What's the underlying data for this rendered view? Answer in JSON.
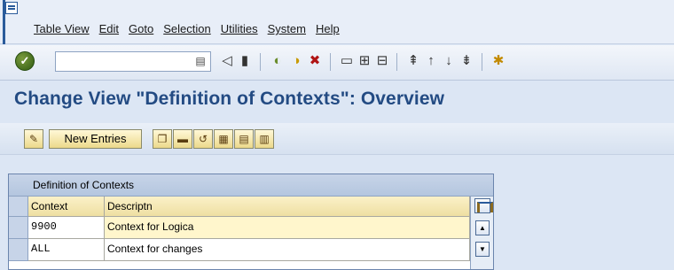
{
  "menu": [
    "Table View",
    "Edit",
    "Goto",
    "Selection",
    "Utilities",
    "System",
    "Help"
  ],
  "toolbar": {
    "command_value": "",
    "icons": [
      "enter-icon",
      "save-icon",
      "back-icon",
      "exit-icon",
      "cancel-icon",
      "print-icon",
      "find-icon",
      "find-next-icon",
      "first-page-icon",
      "previous-page-icon",
      "next-page-icon",
      "last-page-icon",
      "create-session-icon"
    ]
  },
  "page_title": "Change View \"Definition of Contexts\": Overview",
  "app_toolbar": {
    "new_entries": "New Entries"
  },
  "table": {
    "title": "Definition of Contexts",
    "columns": [
      "Context",
      "Descriptn"
    ],
    "rows": [
      {
        "context": "9900",
        "description": "Context for Logica"
      },
      {
        "context": "ALL",
        "description": "Context for changes"
      }
    ]
  },
  "colors": {
    "title_blue": "#234b83",
    "header_yellow": "#f5e9b4",
    "selection_blue": "#c7d4e8"
  }
}
